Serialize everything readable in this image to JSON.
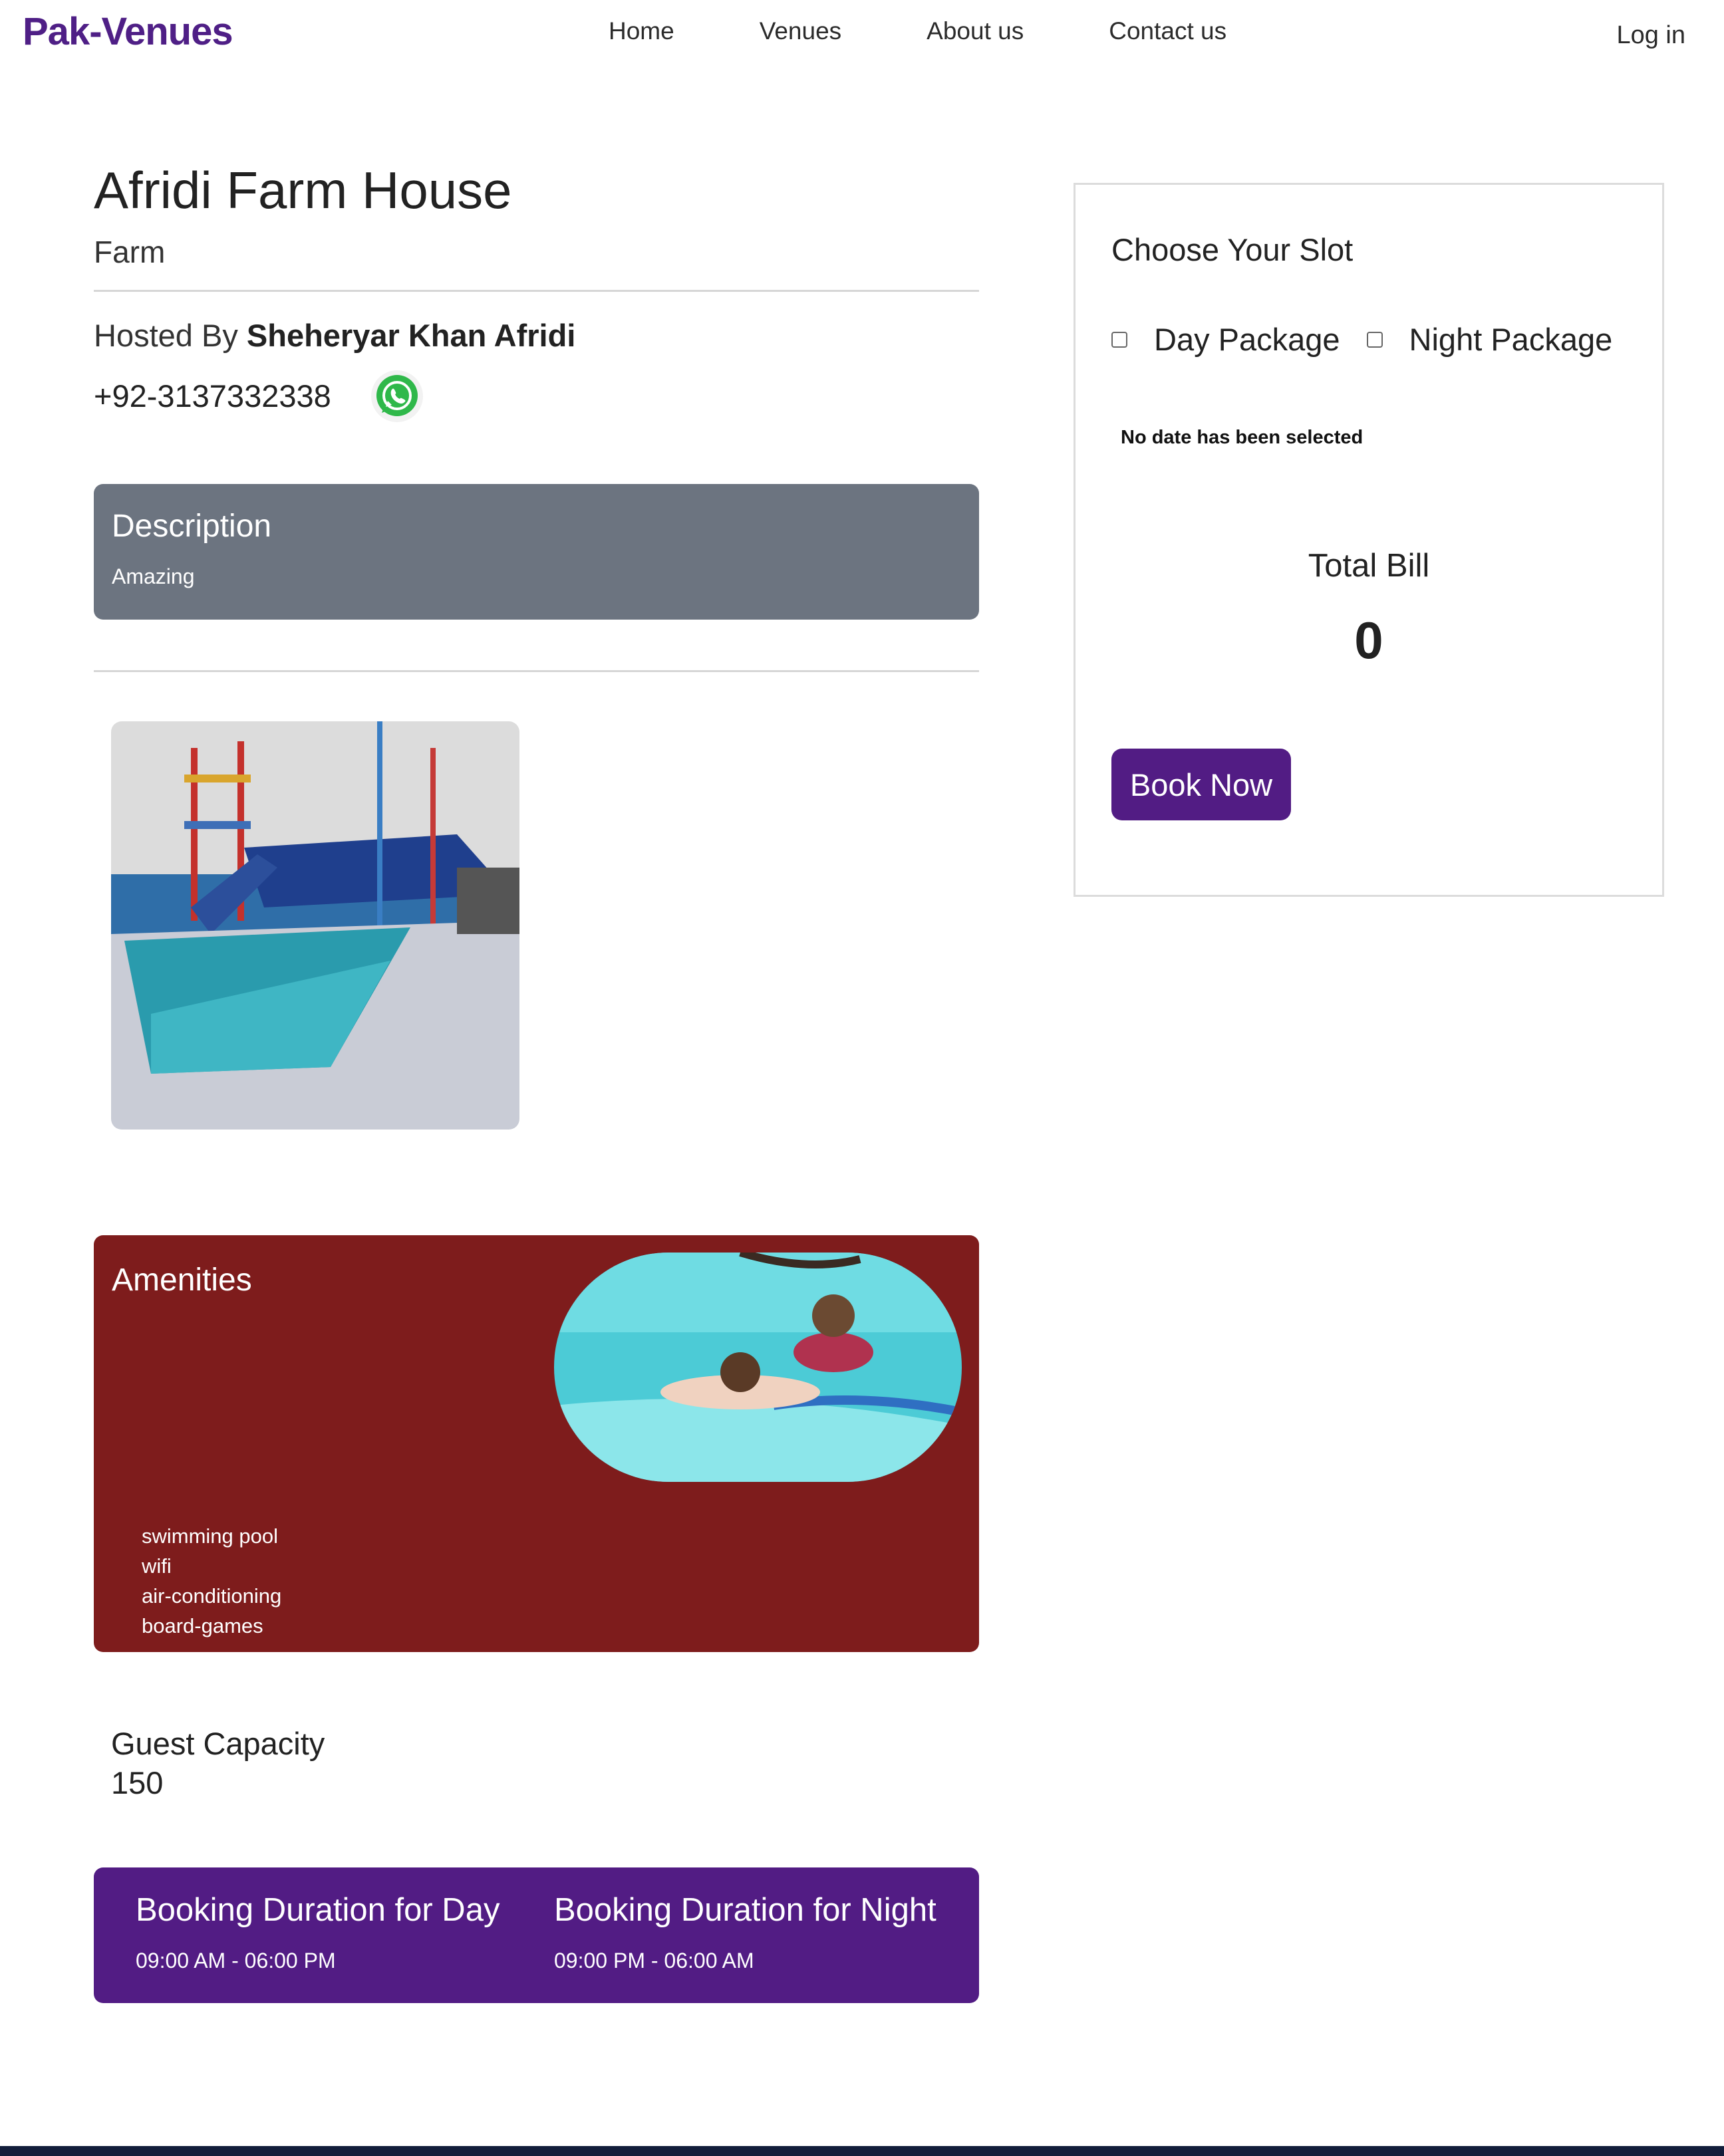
{
  "nav": {
    "brand": "Pak-Venues",
    "links": [
      "Home",
      "Venues",
      "About us",
      "Contact us"
    ],
    "login": "Log in"
  },
  "venue": {
    "title": "Afridi Farm House",
    "type": "Farm",
    "hosted_by_label": "Hosted By",
    "host_name": "Sheheryar Khan Afridi",
    "phone": "+92-3137332338",
    "contact_icon": "whatsapp-icon"
  },
  "description": {
    "title": "Description",
    "text": "Amazing"
  },
  "amenities": {
    "title": "Amenities",
    "items": [
      "swimming pool",
      "wifi",
      "air-conditioning",
      "board-games"
    ]
  },
  "capacity": {
    "label": "Guest Capacity",
    "value": "150"
  },
  "durations": {
    "day_title": "Booking Duration for Day",
    "day_time": "09:00 AM - 06:00 PM",
    "night_title": "Booking Duration for Night",
    "night_time": "09:00 PM - 06:00 AM"
  },
  "booking": {
    "title": "Choose Your Slot",
    "day_package": "Day Package",
    "night_package": "Night Package",
    "date_status": "No date has been selected",
    "total_label": "Total Bill",
    "total_value": "0",
    "book_button": "Book Now"
  },
  "colors": {
    "brand": "#4f1f86",
    "description_bg": "#6c7480",
    "amenities_bg": "#7e1c1c",
    "durations_bg": "#521c84",
    "button_bg": "#521c84"
  }
}
